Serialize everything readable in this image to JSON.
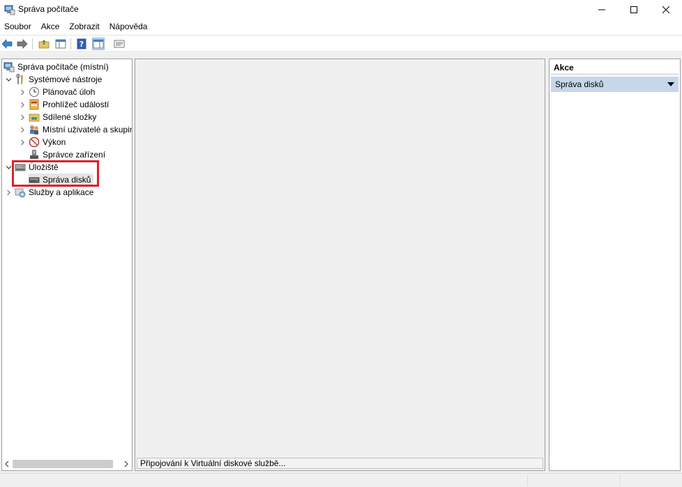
{
  "window": {
    "title": "Správa počítače"
  },
  "menu": {
    "items": [
      "Soubor",
      "Akce",
      "Zobrazit",
      "Nápověda"
    ]
  },
  "tree": {
    "root": "Správa počítače (místní)",
    "items": [
      {
        "label": "Systémové nástroje",
        "icon": "tools-icon"
      },
      {
        "label": "Plánovač úloh",
        "icon": "clock-icon"
      },
      {
        "label": "Prohlížeč událostí",
        "icon": "event-viewer-icon"
      },
      {
        "label": "Sdílené složky",
        "icon": "shared-folder-icon"
      },
      {
        "label": "Místní uživatelé a skupiny",
        "icon": "users-icon"
      },
      {
        "label": "Výkon",
        "icon": "performance-icon"
      },
      {
        "label": "Správce zařízení",
        "icon": "device-manager-icon"
      },
      {
        "label": "Úložiště",
        "icon": "storage-icon"
      },
      {
        "label": "Správa disků",
        "icon": "disk-icon"
      },
      {
        "label": "Služby a aplikace",
        "icon": "services-icon"
      }
    ]
  },
  "center": {
    "status": "Připojování k Virtuální diskové službě..."
  },
  "actions": {
    "header": "Akce",
    "section": "Správa disků"
  },
  "colors": {
    "highlight": "#e0202a",
    "action_selected_bg": "#c6d7ea"
  }
}
